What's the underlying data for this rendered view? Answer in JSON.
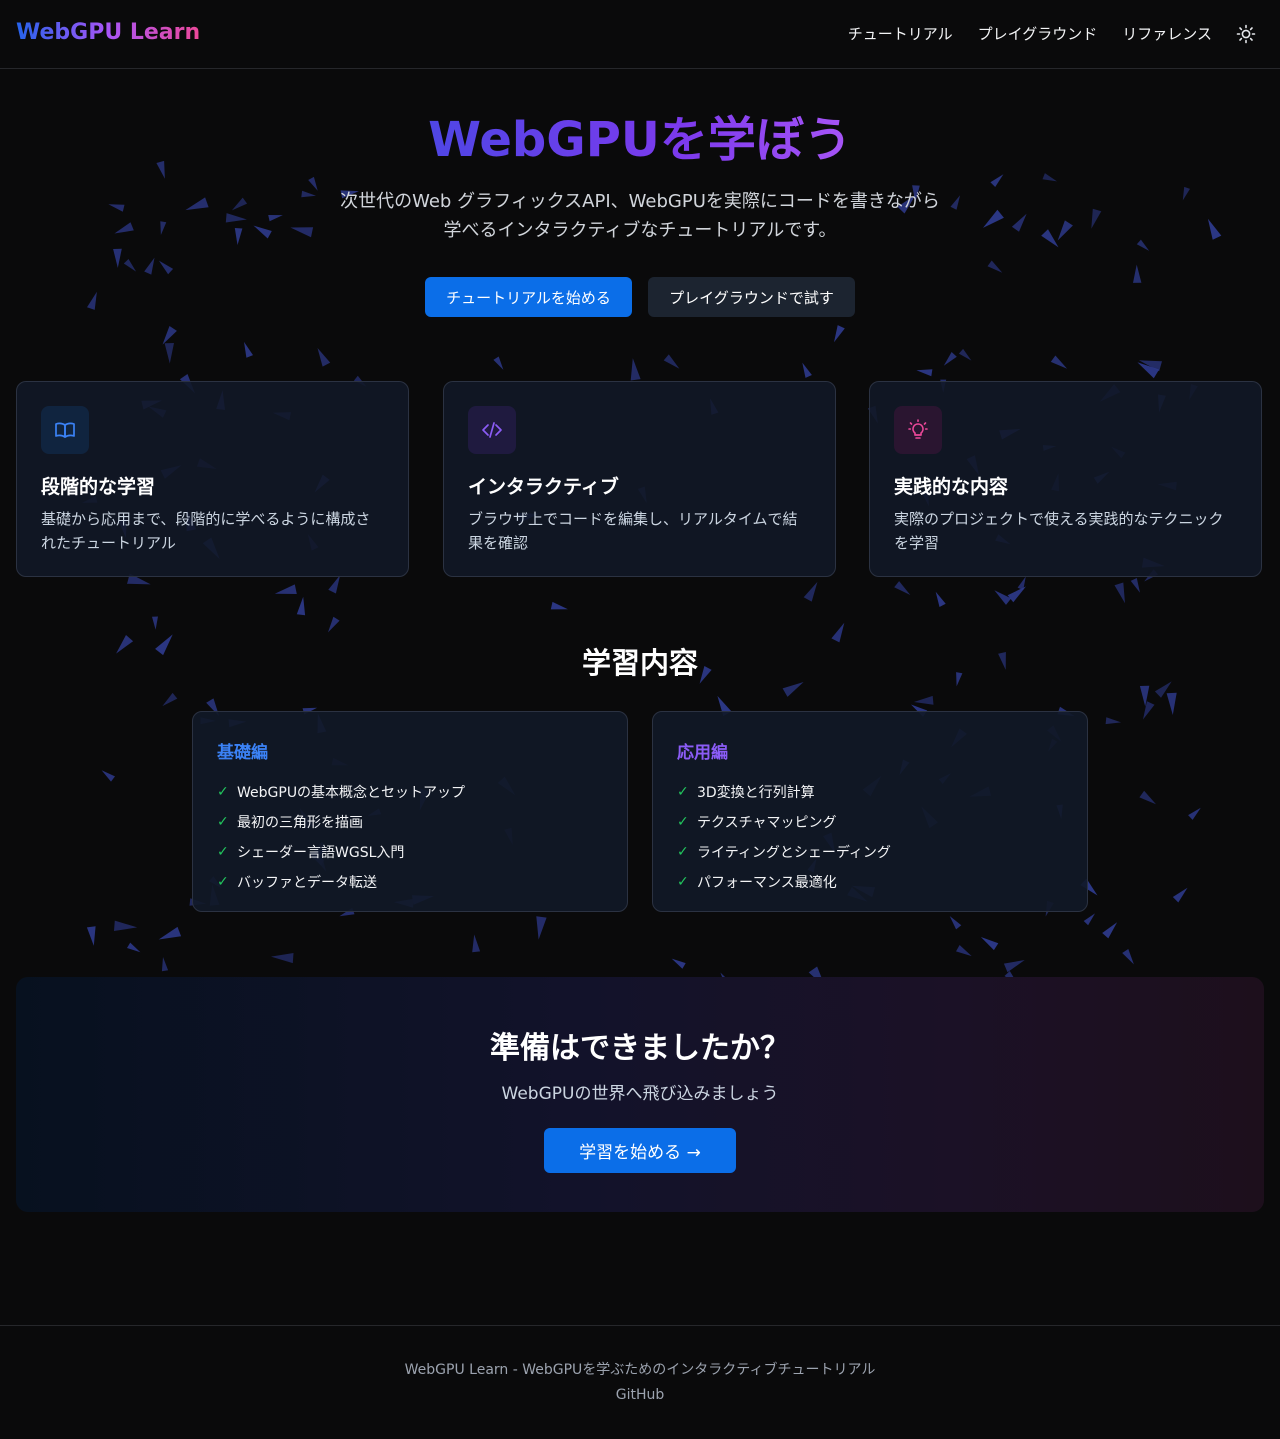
{
  "header": {
    "logo": "WebGPU Learn",
    "nav": [
      "チュートリアル",
      "プレイグラウンド",
      "リファレンス"
    ],
    "theme_icon": "sun-icon"
  },
  "hero": {
    "title": "WebGPUを学ぼう",
    "subtitle_line1": "次世代のWeb グラフィックスAPI、WebGPUを実際にコードを書きながら",
    "subtitle_line2": "学べるインタラクティブなチュートリアルです。",
    "primary_button": "チュートリアルを始める",
    "secondary_button": "プレイグラウンドで試す"
  },
  "features": [
    {
      "icon": "book-open-icon",
      "title": "段階的な学習",
      "desc": "基礎から応用まで、段階的に学べるように構成されたチュートリアル"
    },
    {
      "icon": "code-icon",
      "title": "インタラクティブ",
      "desc": "ブラウザ上でコードを編集し、リアルタイムで結果を確認"
    },
    {
      "icon": "lightbulb-icon",
      "title": "実践的な内容",
      "desc": "実際のプロジェクトで使える実践的なテクニックを学習"
    }
  ],
  "curriculum": {
    "title": "学習内容",
    "basic": {
      "title": "基礎編",
      "items": [
        "WebGPUの基本概念とセットアップ",
        "最初の三角形を描画",
        "シェーダー言語WGSL入門",
        "バッファとデータ転送"
      ]
    },
    "advanced": {
      "title": "応用編",
      "items": [
        "3D変換と行列計算",
        "テクスチャマッピング",
        "ライティングとシェーディング",
        "パフォーマンス最適化"
      ]
    }
  },
  "cta": {
    "title": "準備はできましたか？",
    "subtitle": "WebGPUの世界へ飛び込みましょう",
    "button": "学習を始める →"
  },
  "footer": {
    "text": "WebGPU Learn - WebGPUを学ぶためのインタラクティブチュートリアル",
    "link": "GitHub"
  },
  "colors": {
    "background": "#0a0a0b",
    "primary": "#0b6ee8",
    "blue_accent": "#2563eb",
    "purple_accent": "#7c3aed",
    "pink_accent": "#ec4899",
    "check": "#22c55e",
    "triangles": "#2e3a8c"
  }
}
